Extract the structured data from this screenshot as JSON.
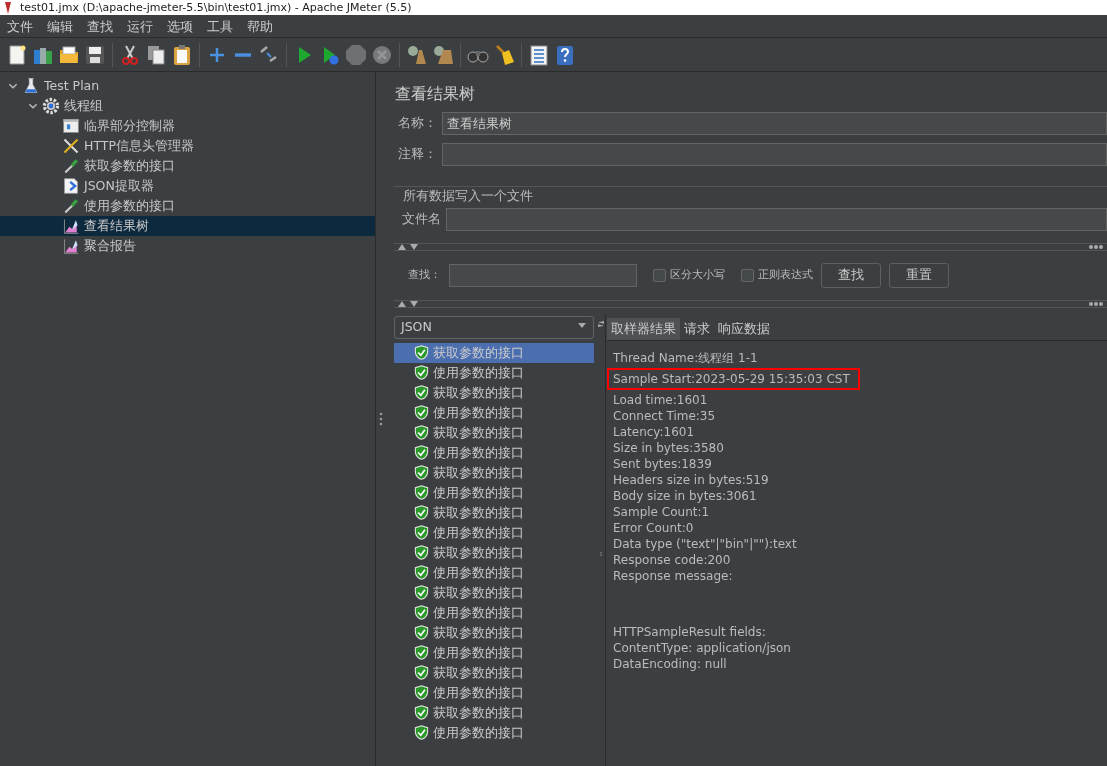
{
  "window": {
    "title": "test01.jmx (D:\\apache-jmeter-5.5\\bin\\test01.jmx) - Apache JMeter (5.5)"
  },
  "menu": [
    "文件",
    "编辑",
    "查找",
    "运行",
    "选项",
    "工具",
    "帮助"
  ],
  "toolbar": [
    [
      {
        "kind": "new",
        "disabled": false
      },
      {
        "kind": "templates",
        "disabled": false
      },
      {
        "kind": "open",
        "disabled": false
      },
      {
        "kind": "save",
        "disabled": false
      }
    ],
    [
      {
        "kind": "cut",
        "disabled": false
      },
      {
        "kind": "copy",
        "disabled": false
      },
      {
        "kind": "paste",
        "disabled": false
      }
    ],
    [
      {
        "kind": "expand",
        "disabled": false
      },
      {
        "kind": "collapse",
        "disabled": false
      },
      {
        "kind": "toggle",
        "disabled": false
      }
    ],
    [
      {
        "kind": "start",
        "disabled": false
      },
      {
        "kind": "start_no_pause",
        "disabled": false
      },
      {
        "kind": "stop",
        "disabled": true
      },
      {
        "kind": "shutdown",
        "disabled": true
      }
    ],
    [
      {
        "kind": "clear",
        "disabled": false
      },
      {
        "kind": "clear_all",
        "disabled": false
      }
    ],
    [
      {
        "kind": "search",
        "disabled": false
      },
      {
        "kind": "reset_search",
        "disabled": false
      }
    ],
    [
      {
        "kind": "functions",
        "disabled": false
      },
      {
        "kind": "help",
        "disabled": false
      }
    ]
  ],
  "tree": [
    {
      "label": "Test Plan",
      "kind": "plan",
      "expanded": true,
      "selected": false,
      "children": [
        {
          "label": "线程组",
          "kind": "threads",
          "expanded": true,
          "selected": false,
          "children": [
            {
              "label": "临界部分控制器",
              "kind": "controller",
              "selected": false
            },
            {
              "label": "HTTP信息头管理器",
              "kind": "config",
              "selected": false
            },
            {
              "label": "获取参数的接口",
              "kind": "sampler",
              "selected": false
            },
            {
              "label": "JSON提取器",
              "kind": "extractor",
              "selected": false
            },
            {
              "label": "使用参数的接口",
              "kind": "sampler",
              "selected": false
            },
            {
              "label": "查看结果树",
              "kind": "listener",
              "selected": true
            },
            {
              "label": "聚合报告",
              "kind": "listener",
              "selected": false
            }
          ]
        }
      ]
    }
  ],
  "panel": {
    "title": "查看结果树",
    "name_label": "名称：",
    "name_value": "查看结果树",
    "comment_label": "注释：",
    "file_group": "所有数据写入一个文件",
    "file_label": "文件名",
    "search": {
      "label": "查找：",
      "options": [
        {
          "label": "区分大小写",
          "checked": false
        },
        {
          "label": "正则表达式",
          "checked": false
        }
      ],
      "buttons": [
        "查找",
        "重置"
      ]
    },
    "renderer": "JSON",
    "results": [
      {
        "label": "获取参数的接口",
        "selected": true
      },
      {
        "label": "使用参数的接口",
        "selected": false
      },
      {
        "label": "获取参数的接口",
        "selected": false
      },
      {
        "label": "使用参数的接口",
        "selected": false
      },
      {
        "label": "获取参数的接口",
        "selected": false
      },
      {
        "label": "使用参数的接口",
        "selected": false
      },
      {
        "label": "获取参数的接口",
        "selected": false
      },
      {
        "label": "使用参数的接口",
        "selected": false
      },
      {
        "label": "获取参数的接口",
        "selected": false
      },
      {
        "label": "使用参数的接口",
        "selected": false
      },
      {
        "label": "获取参数的接口",
        "selected": false
      },
      {
        "label": "使用参数的接口",
        "selected": false
      },
      {
        "label": "获取参数的接口",
        "selected": false
      },
      {
        "label": "使用参数的接口",
        "selected": false
      },
      {
        "label": "获取参数的接口",
        "selected": false
      },
      {
        "label": "使用参数的接口",
        "selected": false
      },
      {
        "label": "获取参数的接口",
        "selected": false
      },
      {
        "label": "使用参数的接口",
        "selected": false
      },
      {
        "label": "获取参数的接口",
        "selected": false
      },
      {
        "label": "使用参数的接口",
        "selected": false
      }
    ],
    "tabs": [
      {
        "label": "取样器结果",
        "selected": true
      },
      {
        "label": "请求",
        "selected": false
      },
      {
        "label": "响应数据",
        "selected": false
      }
    ],
    "details": [
      {
        "text": "Thread Name:线程组 1-1",
        "highlighted": false
      },
      {
        "text": "Sample Start:2023-05-29 15:35:03 CST",
        "highlighted": true
      },
      {
        "text": "Load time:1601",
        "highlighted": false
      },
      {
        "text": "Connect Time:35",
        "highlighted": false
      },
      {
        "text": "Latency:1601",
        "highlighted": false
      },
      {
        "text": "Size in bytes:3580",
        "highlighted": false
      },
      {
        "text": "Sent bytes:1839",
        "highlighted": false
      },
      {
        "text": "Headers size in bytes:519",
        "highlighted": false
      },
      {
        "text": "Body size in bytes:3061",
        "highlighted": false
      },
      {
        "text": "Sample Count:1",
        "highlighted": false
      },
      {
        "text": "Error Count:0",
        "highlighted": false
      },
      {
        "text": "Data type (\"text\"|\"bin\"|\"\"):text",
        "highlighted": false
      },
      {
        "text": "Response code:200",
        "highlighted": false
      },
      {
        "text": "Response message:",
        "highlighted": false
      }
    ],
    "fields": [
      "HTTPSampleResult fields:",
      "ContentType: application/json",
      "DataEncoding: null"
    ]
  }
}
